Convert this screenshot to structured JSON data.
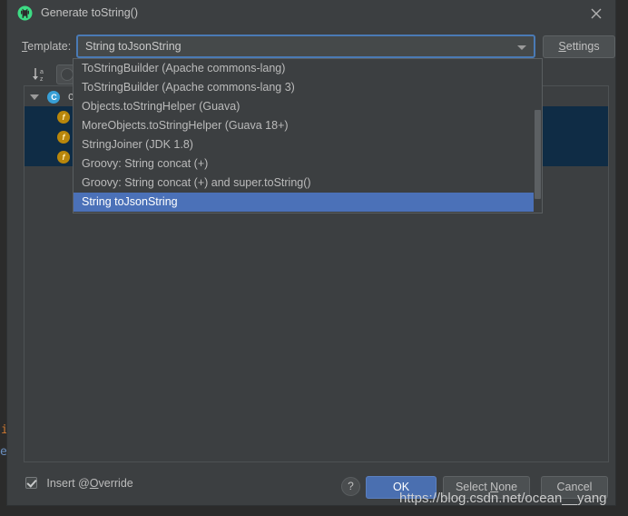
{
  "dialog": {
    "title": "Generate toString()",
    "app_icon": "android-studio-icon",
    "close_icon": "close-icon"
  },
  "template_row": {
    "label_prefix": "T",
    "label_rest": "emplate:",
    "combo_value": "String toJsonString",
    "combo_arrow_icon": "chevron-down-icon",
    "settings_prefix": "S",
    "settings_rest": "ettings"
  },
  "members_toolbar": {
    "sort_icon": "sort-alphabetically-icon",
    "circle_toggle_icon": "circle-toggle-icon"
  },
  "members_tree": {
    "class_node": {
      "icon": "class-icon",
      "icon_letter": "C",
      "label": "com"
    },
    "fields": [
      {
        "icon": "field-icon",
        "icon_letter": "f",
        "label": ""
      },
      {
        "icon": "field-icon",
        "icon_letter": "f",
        "label": ""
      },
      {
        "icon": "field-icon",
        "icon_letter": "f",
        "label": ""
      }
    ]
  },
  "template_dropdown": {
    "items": [
      {
        "label": "ToStringBuilder (Apache commons-lang)",
        "selected": false
      },
      {
        "label": "ToStringBuilder (Apache commons-lang 3)",
        "selected": false
      },
      {
        "label": "Objects.toStringHelper (Guava)",
        "selected": false
      },
      {
        "label": "MoreObjects.toStringHelper (Guava 18+)",
        "selected": false
      },
      {
        "label": "StringJoiner (JDK 1.8)",
        "selected": false
      },
      {
        "label": "Groovy: String concat (+)",
        "selected": false
      },
      {
        "label": "Groovy: String concat (+) and super.toString()",
        "selected": false
      },
      {
        "label": "String toJsonString",
        "selected": true
      }
    ]
  },
  "bottom_bar": {
    "insert_override_prefix": "Insert @",
    "insert_override_mnemonic": "O",
    "insert_override_rest": "verride",
    "insert_override_checked": true,
    "help_label": "?",
    "ok_label": "OK",
    "select_none_prefix": "Select ",
    "select_none_mnemonic": "N",
    "select_none_rest": "one",
    "cancel_label": "Cancel"
  },
  "watermark": {
    "text": "https://blog.csdn.net/ocean__yang"
  },
  "ide_background": {
    "char_i": "i",
    "char_e": "e"
  },
  "colors": {
    "dialog_bg": "#3c3f41",
    "ide_bg": "#2b2b2b",
    "accent_focus": "#4a7ab5",
    "dropdown_selected": "#4b71b8",
    "tree_selected": "#0f2c45",
    "ok_button": "#4a6fb0",
    "class_icon": "#389fd6",
    "field_icon": "#b8860b"
  }
}
